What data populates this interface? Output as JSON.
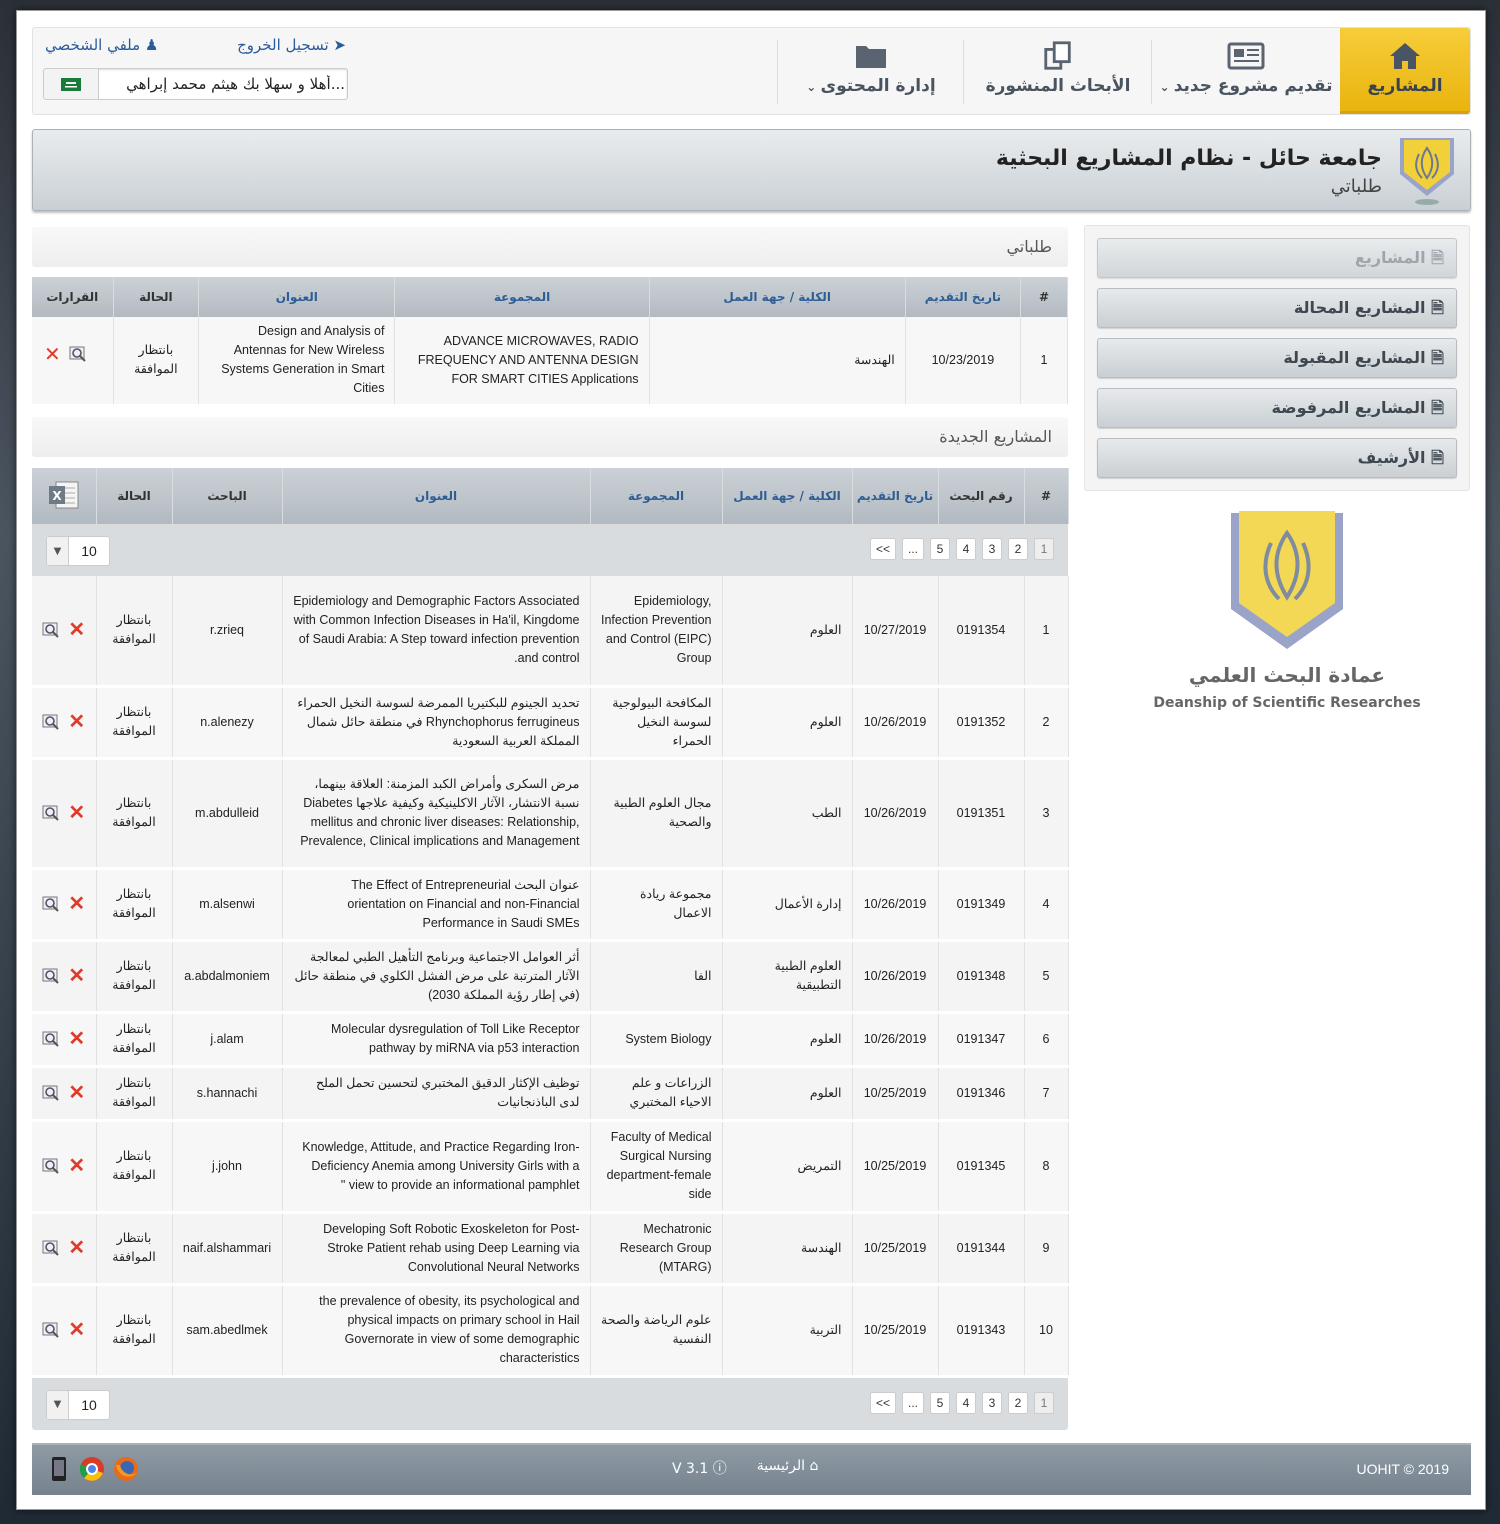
{
  "nav": {
    "home": "المشاريع",
    "new_project": "تقديم مشروع جديد",
    "published": "الأبحاث المنشورة",
    "content": "إدارة المحتوى"
  },
  "user": {
    "profile": "ملفي الشخصي",
    "logout": "تسجيل الخروج",
    "welcome": "أهلا و سهلا بك هيثم محمد إبراهي..."
  },
  "banner": {
    "title": "جامعة حائل - نظام المشاريع البحثية",
    "subtitle": "طلباتي"
  },
  "sidebar": {
    "items": [
      {
        "label": "المشاريع"
      },
      {
        "label": "المشاريع المحالة"
      },
      {
        "label": "المشاريع المقبولة"
      },
      {
        "label": "المشاريع المرفوضة"
      },
      {
        "label": "الأرشيف"
      }
    ],
    "dean_ar": "عمادة البحث العلمي",
    "dean_en": "Deanship of Scientific Researches"
  },
  "my_requests": {
    "title": "طلباتي",
    "headers": {
      "num": "#",
      "date": "تاريخ التقديم",
      "college": "الكلية / جهة العمل",
      "group": "المجموعة",
      "title": "العنوان",
      "status": "الحالة",
      "decisions": "القرارات"
    },
    "rows": [
      {
        "num": "1",
        "date": "10/23/2019",
        "college": "الهندسة",
        "group": "ADVANCE MICROWAVES, RADIO FREQUENCY AND ANTENNA DESIGN FOR SMART CITIES Applications",
        "title": "Design and Analysis of Antennas for New Wireless Systems Generation in Smart Cities",
        "status": "بانتظار الموافقة"
      }
    ]
  },
  "new_projects": {
    "title": "المشاريع الجديدة",
    "headers": {
      "num": "#",
      "research_no": "رقم البحث",
      "date": "تاريخ التقديم",
      "college": "الكلية / جهة العمل",
      "group": "المجموعة",
      "title": "العنوان",
      "researcher": "الباحث",
      "status": "الحالة"
    },
    "pages": [
      "1",
      "2",
      "3",
      "4",
      "5",
      "...",
      "<<"
    ],
    "page_size": "10",
    "rows": [
      {
        "num": "1",
        "rno": "0191354",
        "date": "10/27/2019",
        "college": "العلوم",
        "group": "Epidemiology, Infection Prevention and Control (EIPC) Group",
        "title": "Epidemiology and Demographic Factors Associated with Common Infection Diseases in Ha'il, Kingdome of Saudi Arabia: A Step toward infection prevention and control.",
        "researcher": "r.zrieq",
        "status": "بانتظار الموافقة"
      },
      {
        "num": "2",
        "rno": "0191352",
        "date": "10/26/2019",
        "college": "العلوم",
        "group": "المكافحة البيولوجية لسوسة النخيل الحمراء",
        "title": "تحديد الجينوم للبكتيريا الممرضة لسوسة النخيل الحمراء Rhynchophorus ferrugineus في منطقة حائل شمال المملكة العربية السعودية",
        "researcher": "n.alenezy",
        "status": "بانتظار الموافقة"
      },
      {
        "num": "3",
        "rno": "0191351",
        "date": "10/26/2019",
        "college": "الطب",
        "group": "مجال العلوم الطبية والصحية",
        "title": "مرض السكرى وأمراض الكبد المزمنة: العلاقة بينهما، نسبة الانتشار، الآثار الاكلينيكية وكيفية علاجها Diabetes mellitus and chronic liver diseases: Relationship, Prevalence, Clinical implications and Management",
        "researcher": "m.abdulleid",
        "status": "بانتظار الموافقة"
      },
      {
        "num": "4",
        "rno": "0191349",
        "date": "10/26/2019",
        "college": "إدارة الأعمال",
        "group": "مجموعة ريادة الاعمال",
        "title": "عنوان البحث The Effect of Entrepreneurial orientation on Financial and non-Financial Performance in Saudi SMEs",
        "researcher": "m.alsenwi",
        "status": "بانتظار الموافقة"
      },
      {
        "num": "5",
        "rno": "0191348",
        "date": "10/26/2019",
        "college": "العلوم الطبية التطبيقية",
        "group": "الفا",
        "title": "أثر العوامل الاجتماعية وبرنامج التأهيل الطبي لمعالجة الآثار المترتبة على مرض الفشل الكلوي في منطقة حائل (في إطار رؤية المملكة 2030)",
        "researcher": "a.abdalmoniem",
        "status": "بانتظار الموافقة"
      },
      {
        "num": "6",
        "rno": "0191347",
        "date": "10/26/2019",
        "college": "العلوم",
        "group": "System Biology",
        "title": "Molecular dysregulation of Toll Like Receptor pathway by miRNA via p53 interaction",
        "researcher": "j.alam",
        "status": "بانتظار الموافقة"
      },
      {
        "num": "7",
        "rno": "0191346",
        "date": "10/25/2019",
        "college": "العلوم",
        "group": "الزراعات و علم الاحياء المختبري",
        "title": "توظيف الإكثار الدقيق المختبري لتحسين تحمل الملح لدى الباذنجانيات",
        "researcher": "s.hannachi",
        "status": "بانتظار الموافقة"
      },
      {
        "num": "8",
        "rno": "0191345",
        "date": "10/25/2019",
        "college": "التمريض",
        "group": "Faculty of Medical Surgical Nursing department-female side",
        "title": "Knowledge, Attitude, and Practice Regarding Iron-Deficiency Anemia among University Girls with a view to provide an informational pamphlet \"",
        "researcher": "j.john",
        "status": "بانتظار الموافقة"
      },
      {
        "num": "9",
        "rno": "0191344",
        "date": "10/25/2019",
        "college": "الهندسة",
        "group": "Mechatronic Research Group (MTARG)",
        "title": "Developing Soft Robotic Exoskeleton for Post-Stroke Patient rehab using Deep Learning via Convolutional Neural Networks",
        "researcher": "naif.alshammari",
        "status": "بانتظار الموافقة"
      },
      {
        "num": "10",
        "rno": "0191343",
        "date": "10/25/2019",
        "college": "التربية",
        "group": "علوم الرياضة والصحة النفسية",
        "title": "the prevalence of obesity, its psychological and physical impacts on primary school in Hail Governorate in view of some demographic characteristics",
        "researcher": "sam.abedlmek",
        "status": "بانتظار الموافقة"
      }
    ]
  },
  "footer": {
    "copyright": "UOHIT © 2019",
    "home": "الرئيسية",
    "version": "V 3.1"
  },
  "colors": {
    "accent": "#f2c52b",
    "link": "#2a5b9a",
    "header": "#b8c0c6"
  }
}
